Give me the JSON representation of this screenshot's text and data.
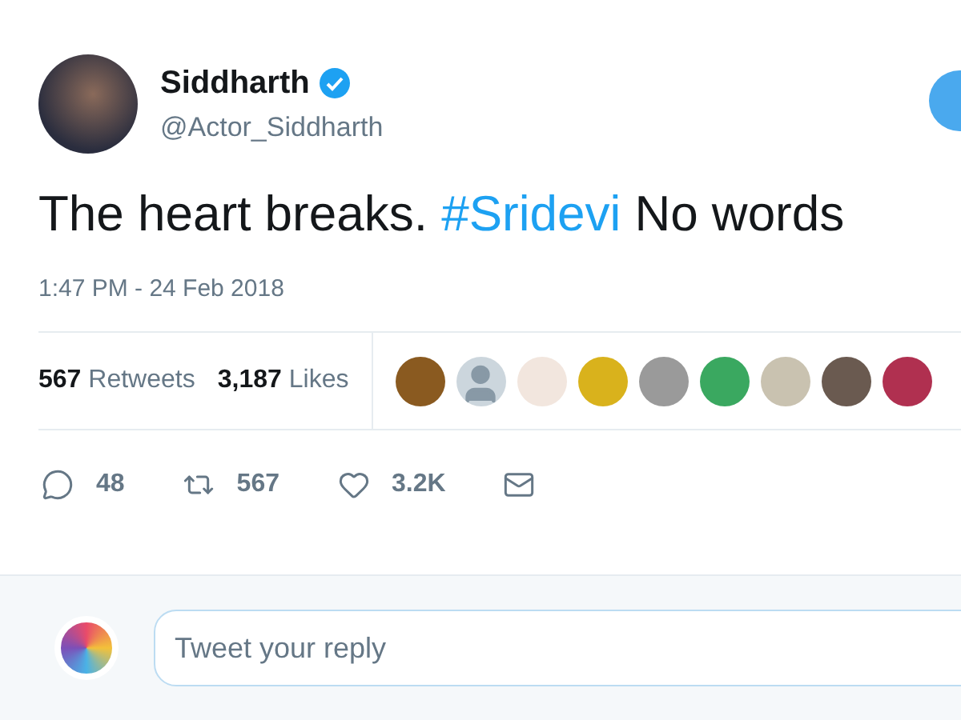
{
  "author": {
    "name": "Siddharth",
    "verified": true,
    "handle": "@Actor_Siddharth"
  },
  "tweet": {
    "parts": [
      {
        "kind": "text",
        "text": "The heart breaks. "
      },
      {
        "kind": "hashtag",
        "text": "#Sridevi"
      },
      {
        "kind": "text",
        "text": " No words"
      }
    ],
    "time": "1:47 PM - 24 Feb 2018"
  },
  "stats": [
    {
      "count": "567",
      "label": "Retweets"
    },
    {
      "count": "3,187",
      "label": "Likes"
    }
  ],
  "actions": [
    {
      "kind": "reply",
      "count": "48"
    },
    {
      "kind": "retweet",
      "count": "567"
    },
    {
      "kind": "like",
      "count": "3.2K"
    },
    {
      "kind": "message"
    }
  ],
  "reply": {
    "placeholder": "Tweet your reply"
  }
}
